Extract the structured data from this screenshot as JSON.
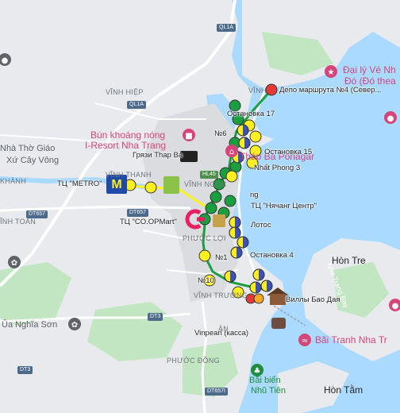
{
  "place_labels": [
    {
      "text": "Nhà Thờ Giáo",
      "cls": "place"
    },
    {
      "text": "Xứ Cây Vông",
      "cls": "place"
    },
    {
      "text": "KHÁNH",
      "cls": "place-small"
    },
    {
      "text": "VĨNH HIỆP",
      "cls": "place-small"
    },
    {
      "text": "VĨNH THANH",
      "cls": "place-small"
    },
    {
      "text": "VĨNH NGỌC",
      "cls": "place-small"
    },
    {
      "text": "ĨNH TOÀN",
      "cls": "place-small"
    },
    {
      "text": "PHƯỚC ĐỒNG",
      "cls": "place-small"
    },
    {
      "text": "PHƯỚC LỢI",
      "cls": "place-small"
    },
    {
      "text": "VĨNH TRƯỜNG",
      "cls": "place-small"
    },
    {
      "text": "ÀN",
      "cls": "place-small"
    },
    {
      "text": "VĨNH",
      "cls": "place-small"
    },
    {
      "text": "Hòn Tre",
      "cls": "island"
    },
    {
      "text": "Hòn Tằm",
      "cls": "island"
    },
    {
      "text": "Nha Trang Bay",
      "cls": "bay"
    },
    {
      "text": "Ủa Nghĩa Sơn",
      "cls": "place"
    }
  ],
  "poi_labels": [
    {
      "text": "Bún khoáng nóng",
      "cls": "poi"
    },
    {
      "text": "I-Resort Nha Trang",
      "cls": "poi"
    },
    {
      "text": "Đại lý Vé Nh",
      "cls": "poi"
    },
    {
      "text": "Đó (Đó thea",
      "cls": "poi"
    },
    {
      "text": "Tháp Bà Ponagar",
      "cls": "poi"
    },
    {
      "text": "Bãi Tranh Nha Tr",
      "cls": "poi"
    },
    {
      "text": "Bãi biển",
      "cls": "poi-green"
    },
    {
      "text": "Nhũ Tiên",
      "cls": "poi-green"
    }
  ],
  "road_shields": [
    {
      "text": "QL1A",
      "cls": ""
    },
    {
      "text": "QL1A",
      "cls": ""
    },
    {
      "text": "DT657",
      "cls": ""
    },
    {
      "text": "DT657",
      "cls": ""
    },
    {
      "text": "DT3",
      "cls": ""
    },
    {
      "text": "DT3",
      "cls": ""
    },
    {
      "text": "DT657I",
      "cls": ""
    },
    {
      "text": "HL45",
      "cls": "green"
    }
  ],
  "marker_labels": [
    {
      "text": "Депо маршрута №4 (Север..."
    },
    {
      "text": "Остановка 17"
    },
    {
      "text": "№6"
    },
    {
      "text": "Остановка 15"
    },
    {
      "text": "Грязи Thap Ba"
    },
    {
      "text": "Nhất Phong 3"
    },
    {
      "text": "ТЦ \"METRO\""
    },
    {
      "text": "ТЦ \"Нячанг Центр\""
    },
    {
      "text": "ТЦ \"CO.OPMart\""
    },
    {
      "text": "Лотос"
    },
    {
      "text": "№1"
    },
    {
      "text": "Остановка 4"
    },
    {
      "text": "№10"
    },
    {
      "text": "Виллы Бао Дая"
    },
    {
      "text": "Vinpearl (касса)"
    },
    {
      "text": "ng"
    }
  ],
  "colors": {
    "water": "#aadaff",
    "land": "#e8eaed",
    "urban": "#dadce0",
    "park": "#c3e6c2",
    "road_major": "#ffffff",
    "route_green": "#1a9e3f",
    "route_yellow": "#fcee21",
    "route_orange": "#f9a825",
    "route_blue": "#3f51b5",
    "route_red": "#e53935",
    "metro_blue": "#1f4aa8",
    "lotte_pink": "#e91e63"
  }
}
